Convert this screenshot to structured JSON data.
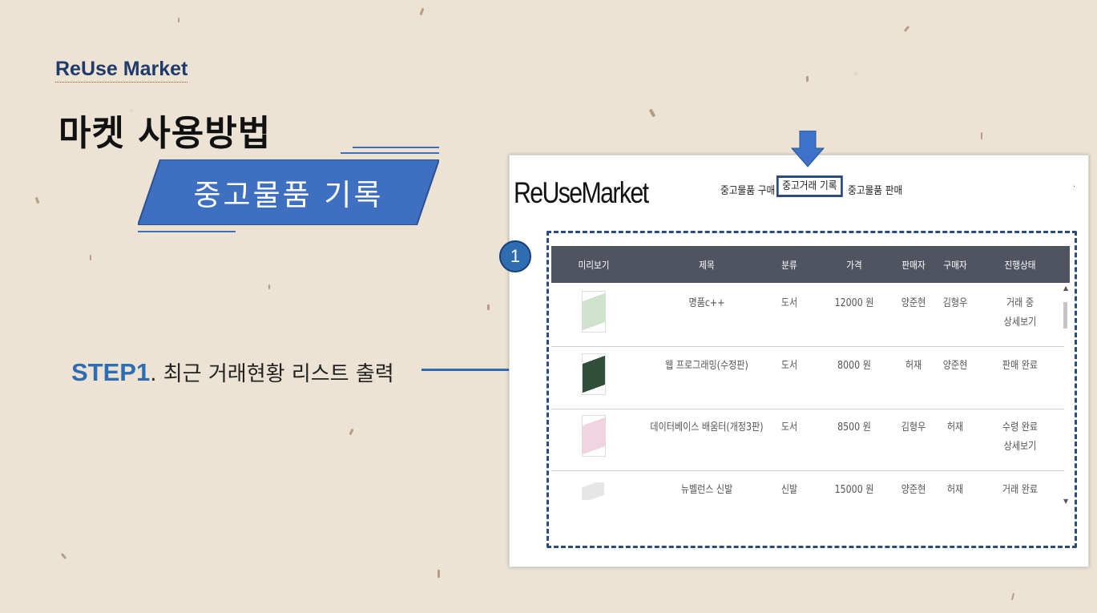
{
  "slide": {
    "brand": "ReUse Market",
    "title": "마켓 사용방법",
    "banner": "중고물품 기록",
    "step_label": "STEP1",
    "step_text": ". 최근 거래현황 리스트 출력",
    "badge": "1"
  },
  "screenshot": {
    "brand": "ReUseMarket",
    "nav": [
      "중고물품 구매",
      "중고거래 기록",
      "중고물품 판매"
    ],
    "active_nav_index": 1,
    "nav_dot": "·",
    "columns": [
      "미리보기",
      "제목",
      "분류",
      "가격",
      "판매자",
      "구매자",
      "진행상태"
    ],
    "rows": [
      {
        "title": "명품c++",
        "category": "도서",
        "price": "12000 원",
        "seller": "양준현",
        "buyer": "김형우",
        "status": "거래 중",
        "detail": "상세보기"
      },
      {
        "title": "웹 프로그래밍(수정판)",
        "category": "도서",
        "price": "8000 원",
        "seller": "허재",
        "buyer": "양준현",
        "status": "판매 완료",
        "detail": ""
      },
      {
        "title": "데이터베이스 배움터(개정3판)",
        "category": "도서",
        "price": "8500 원",
        "seller": "김형우",
        "buyer": "허재",
        "status": "수령 완료",
        "detail": "상세보기"
      },
      {
        "title": "뉴벨런스 신발",
        "category": "신발",
        "price": "15000 원",
        "seller": "양준현",
        "buyer": "허재",
        "status": "거래 완료",
        "detail": ""
      }
    ],
    "thumb_colors": [
      "#cfe3cc",
      "#2f4f3a",
      "#f0d4e0",
      "#e6e6e6"
    ]
  },
  "colors": {
    "accent": "#2e6db2",
    "frame": "#2b4a80",
    "header_bg": "#4f5460",
    "banner": "#3f6fc0"
  }
}
